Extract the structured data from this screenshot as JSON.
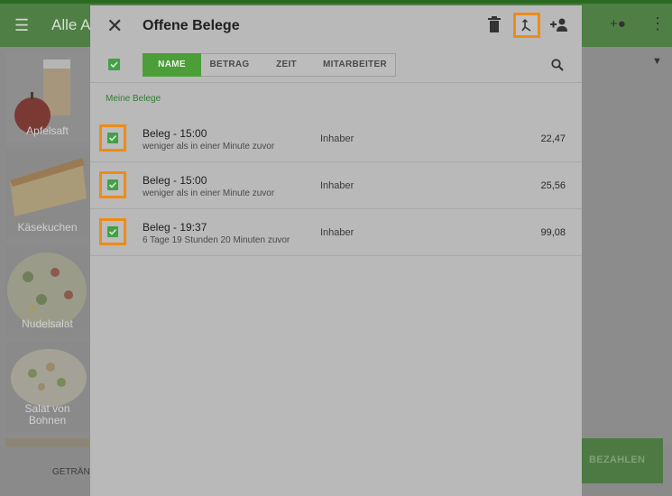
{
  "background": {
    "app_title": "Alle Ar",
    "tiles": [
      {
        "label": "Apfelsaft"
      },
      {
        "label": "Käsekuchen"
      },
      {
        "label": "Nudelsalat"
      },
      {
        "label": "Salat von Bohnen"
      }
    ],
    "bottom_tab": "GETRÄNK",
    "pay_button": "BEZAHLEN"
  },
  "dialog": {
    "title": "Offene Belege",
    "icons": {
      "close": "close-icon",
      "delete": "trash-icon",
      "merge": "merge-icon",
      "assign": "person-add-icon",
      "search": "search-icon"
    },
    "sort_tabs": [
      "NAME",
      "BETRAG",
      "ZEIT",
      "MITARBEITER"
    ],
    "active_sort": "NAME",
    "section_label": "Meine Belege",
    "receipts": [
      {
        "title": "Beleg - 15:00",
        "time_ago": "weniger als in einer Minute zuvor",
        "owner": "Inhaber",
        "amount": "22,47",
        "checked": true
      },
      {
        "title": "Beleg - 15:00",
        "time_ago": "weniger als in einer Minute zuvor",
        "owner": "Inhaber",
        "amount": "25,56",
        "checked": true
      },
      {
        "title": "Beleg - 19:37",
        "time_ago": "6 Tage 19 Stunden 20 Minuten  zuvor",
        "owner": "Inhaber",
        "amount": "99,08",
        "checked": true
      }
    ]
  },
  "colors": {
    "accent_green": "#4c9f38",
    "highlight_orange": "#ef8b16",
    "appbar_green": "#4f7f44"
  }
}
